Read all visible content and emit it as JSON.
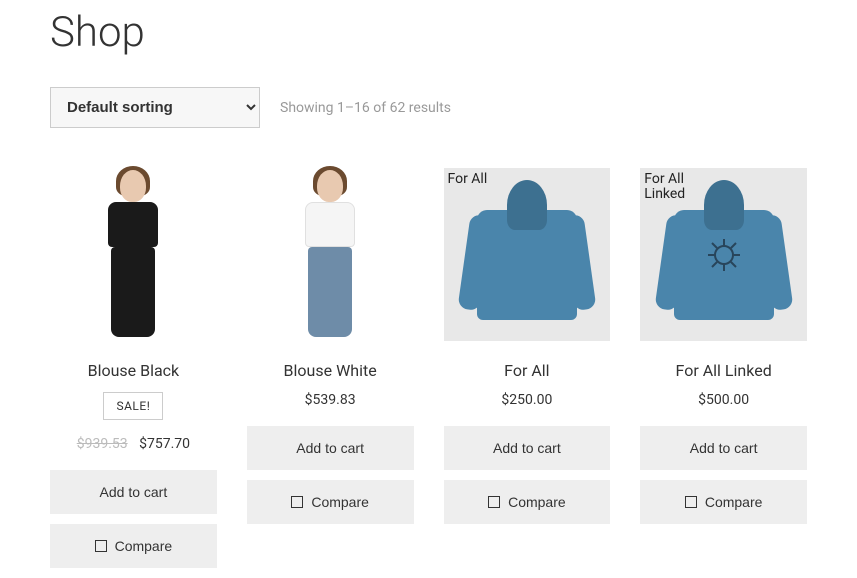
{
  "header": {
    "title": "Shop"
  },
  "controls": {
    "sort_selected": "Default sorting",
    "results_text": "Showing 1–16 of 62 results"
  },
  "labels": {
    "add_to_cart": "Add to cart",
    "compare": "Compare",
    "sale_badge": "SALE!"
  },
  "products": [
    {
      "title": "Blouse Black",
      "on_sale": true,
      "old_price": "$939.53",
      "price": "$757.70",
      "image_variant": "model-black",
      "grey_bg": false,
      "placeholder_label": ""
    },
    {
      "title": "Blouse White",
      "on_sale": false,
      "old_price": "",
      "price": "$539.83",
      "image_variant": "model-white",
      "grey_bg": false,
      "placeholder_label": ""
    },
    {
      "title": "For All",
      "on_sale": false,
      "old_price": "",
      "price": "$250.00",
      "image_variant": "hoodie-plain",
      "grey_bg": true,
      "placeholder_label": "For All"
    },
    {
      "title": "For All Linked",
      "on_sale": false,
      "old_price": "",
      "price": "$500.00",
      "image_variant": "hoodie-design",
      "grey_bg": true,
      "placeholder_label": "For All\nLinked"
    }
  ]
}
